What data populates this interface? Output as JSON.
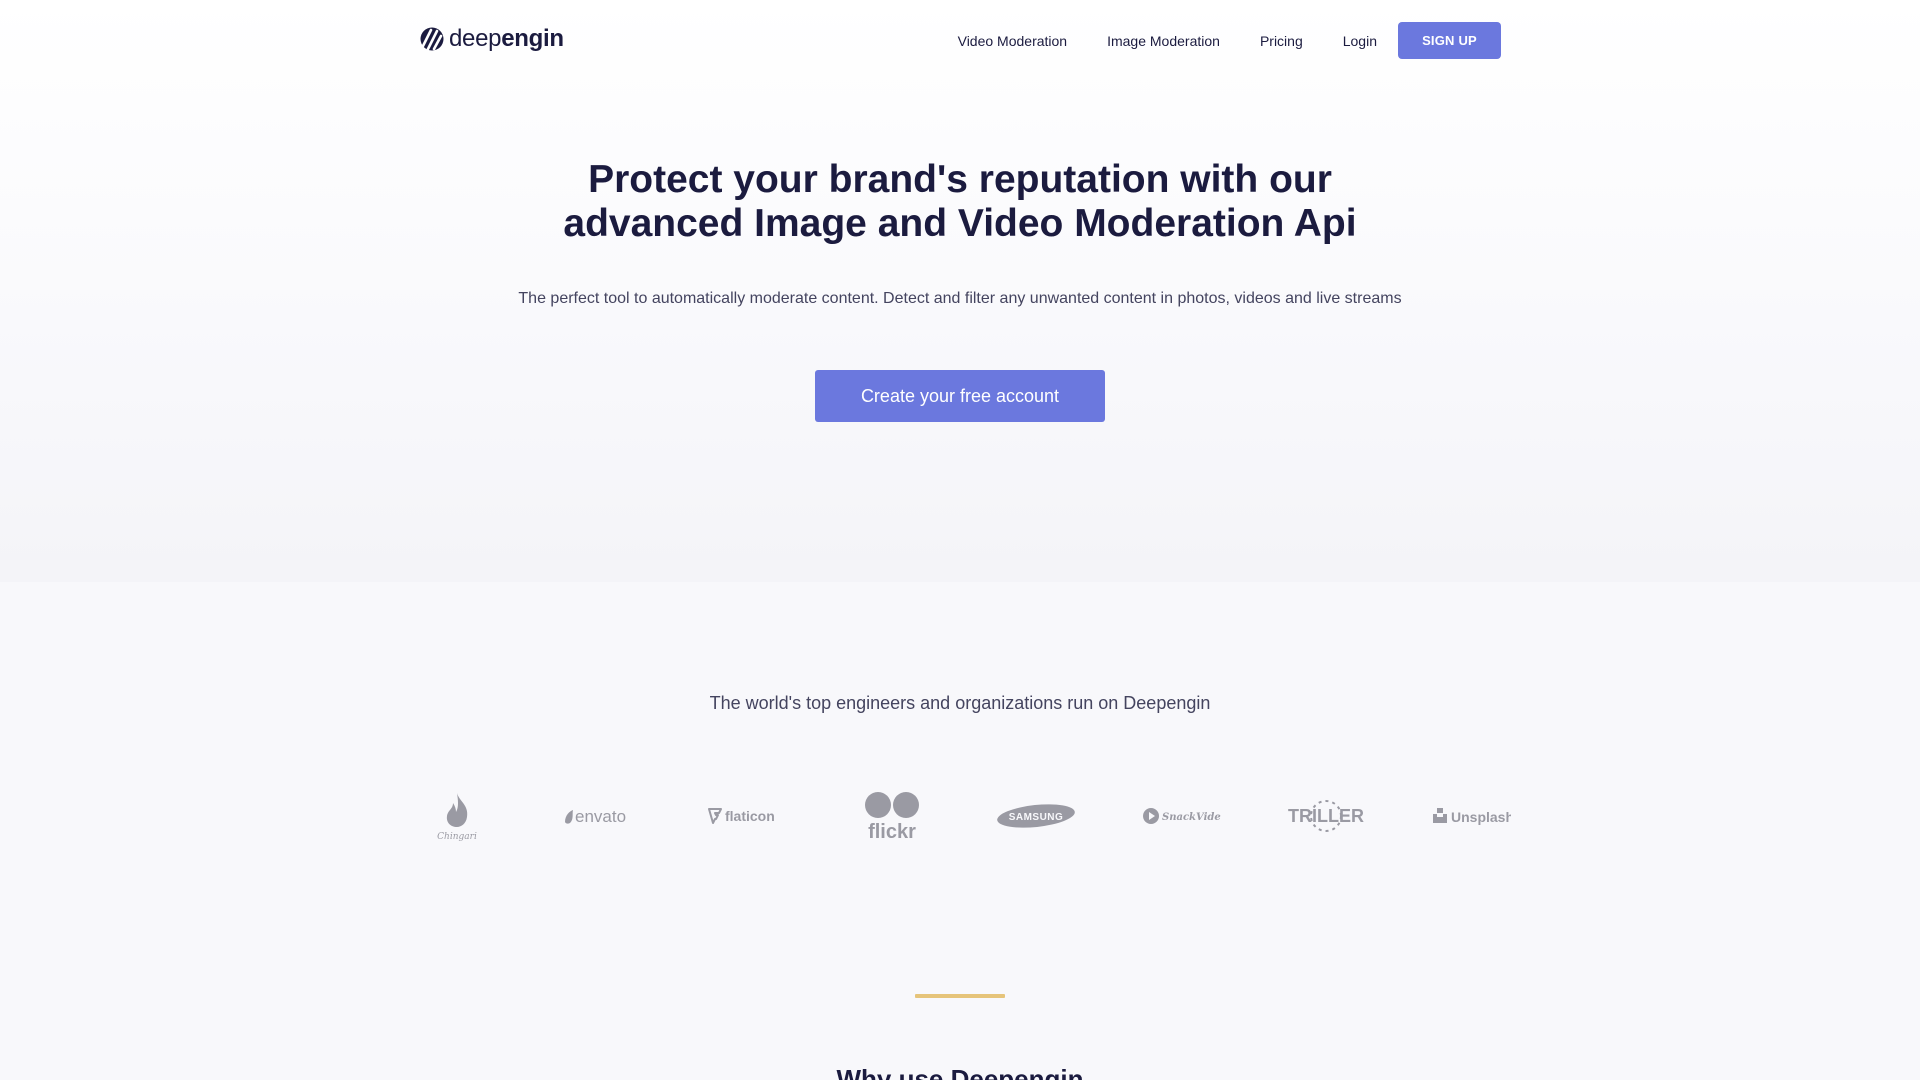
{
  "colors": {
    "accent": "#6b78de",
    "text_dark": "#1b1b3f",
    "text_muted": "#44445f",
    "logo_gray": "#9a9aa3",
    "divider": "#e6c47a"
  },
  "header": {
    "logo": {
      "icon": "deepengin-stripes-icon",
      "text_light": "deep",
      "text_bold": "engin"
    },
    "nav": [
      {
        "label": "Video Moderation"
      },
      {
        "label": "Image Moderation"
      },
      {
        "label": "Pricing"
      },
      {
        "label": "Login"
      }
    ],
    "signup_label": "SIGN UP"
  },
  "hero": {
    "title_line1": "Protect your brand's reputation with our",
    "title_line2": "advanced Image and Video Moderation Api",
    "subtitle": "The perfect tool to automatically moderate content. Detect and filter any unwanted content in photos, videos and live streams",
    "cta_label": "Create your free account"
  },
  "clients": {
    "heading": "The world's top engineers and organizations run on Deepengin",
    "logos": [
      {
        "name": "Chingari",
        "icon": "chingari-flame-icon"
      },
      {
        "name": "envato",
        "icon": "envato-leaf-icon"
      },
      {
        "name": "flaticon",
        "icon": "flaticon-f-icon"
      },
      {
        "name": "flickr",
        "icon": "flickr-dots-icon"
      },
      {
        "name": "SAMSUNG",
        "icon": "samsung-oval-icon"
      },
      {
        "name": "SnackVideo",
        "icon": "snackvideo-icon"
      },
      {
        "name": "TRILLER",
        "icon": "triller-icon"
      },
      {
        "name": "Unsplash",
        "icon": "unsplash-icon"
      }
    ]
  },
  "why_section": {
    "title": "Why use Deepengin"
  }
}
